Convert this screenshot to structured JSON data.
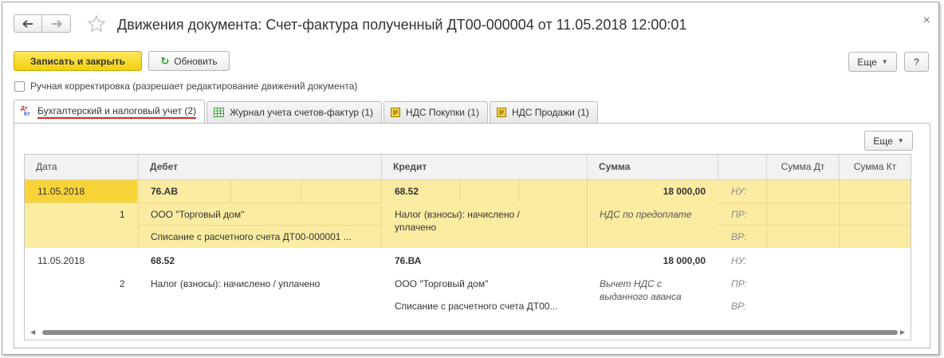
{
  "window": {
    "title": "Движения документа: Счет-фактура полученный ДТ00-000004 от 11.05.2018 12:00:01",
    "close_label": "×"
  },
  "toolbar": {
    "save_close_label": "Записать и закрыть",
    "refresh_label": "Обновить",
    "more_label": "Еще",
    "help_label": "?"
  },
  "manual_edit": {
    "label": "Ручная корректировка (разрешает редактирование движений документа)",
    "checked": false
  },
  "tabs": [
    {
      "label": "Бухгалтерский и налоговый учет (2)",
      "icon": "dt-kt-icon",
      "active": true
    },
    {
      "label": "Журнал учета счетов-фактур (1)",
      "icon": "table-icon",
      "active": false
    },
    {
      "label": "НДС Покупки (1)",
      "icon": "register-icon",
      "active": false
    },
    {
      "label": "НДС Продажи (1)",
      "icon": "register-icon",
      "active": false
    }
  ],
  "panel": {
    "more_label": "Еще"
  },
  "table": {
    "columns": [
      "Дата",
      "Дебет",
      "Кредит",
      "Сумма",
      "",
      "Сумма Дт",
      "Сумма Кт"
    ],
    "rows": [
      {
        "date": "11.05.2018",
        "number": "1",
        "debit_account": "76.АВ",
        "debit_sub1": "ООО \"Торговый дом\"",
        "debit_sub2": "Списание с расчетного счета ДТ00-000001 ...",
        "credit_account": "68.52",
        "credit_sub1": "Налог (взносы): начислено /",
        "credit_sub1b": "уплачено",
        "credit_sub2": "",
        "amount": "18 000,00",
        "description": "НДС по предоплате",
        "description2": "",
        "nu": "НУ:",
        "pr": "ПР:",
        "vr": "ВР:"
      },
      {
        "date": "11.05.2018",
        "number": "2",
        "debit_account": "68.52",
        "debit_sub1": "Налог (взносы): начислено / уплачено",
        "debit_sub2": "",
        "credit_account": "76.ВА",
        "credit_sub1": "ООО \"Торговый дом\"",
        "credit_sub1b": "",
        "credit_sub2": "Списание с расчетного счета ДТ00...",
        "amount": "18 000,00",
        "description": "Вычет НДС с",
        "description2": "выданного аванса",
        "nu": "НУ:",
        "pr": "ПР:",
        "vr": "ВР:"
      }
    ]
  },
  "colors": {
    "primary_button": "#f3cf10",
    "selected_row": "#fbeca2",
    "selected_cell": "#f8d338",
    "active_tab_underline": "#d7281a"
  }
}
